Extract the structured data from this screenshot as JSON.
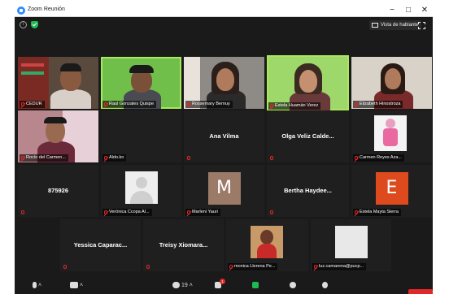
{
  "window": {
    "title": "Zoom Reunión",
    "minimize": "−",
    "maximize": "□",
    "close": "✕"
  },
  "topbar": {
    "view_label": "Vista de hablante"
  },
  "participants_row1": [
    {
      "name": "CEDUR"
    },
    {
      "name": "Raul Gonzales Quispe"
    },
    {
      "name": "Rossemary Bernuy"
    },
    {
      "name": "Estela Huamán Verez"
    },
    {
      "name": "Elizabeth Hinostroza"
    }
  ],
  "participants_row2": [
    {
      "name": "Rocío del Carmen..."
    },
    {
      "name": "Aldo.ko"
    },
    {
      "display": "Ana Vilma"
    },
    {
      "display": "Olga Veliz Calde..."
    },
    {
      "name": "Carmen Reyes Aza..."
    }
  ],
  "participants_row3": [
    {
      "display": "875926"
    },
    {
      "name": "Verónica Ccopa Al..."
    },
    {
      "name": "Marleni Yauri",
      "initial": "M",
      "color": "#9b7a68"
    },
    {
      "display": "Bertha Haydee..."
    },
    {
      "name": "Estela Mayta Sierra",
      "initial": "E",
      "color": "#dd4a1e"
    }
  ],
  "participants_row4": [
    {
      "display": "Yessica Caparac..."
    },
    {
      "display": "Treisy Xiomara..."
    },
    {
      "name": "monica Llerena Pe..."
    },
    {
      "name": "luz.camarena@pucp..."
    }
  ],
  "toolbar": {
    "participants_count": "19",
    "chat_badge": "1"
  },
  "colors": {
    "accent": "#2d8cff",
    "active_speaker": "#a8e85a",
    "muted": "#e02828"
  }
}
